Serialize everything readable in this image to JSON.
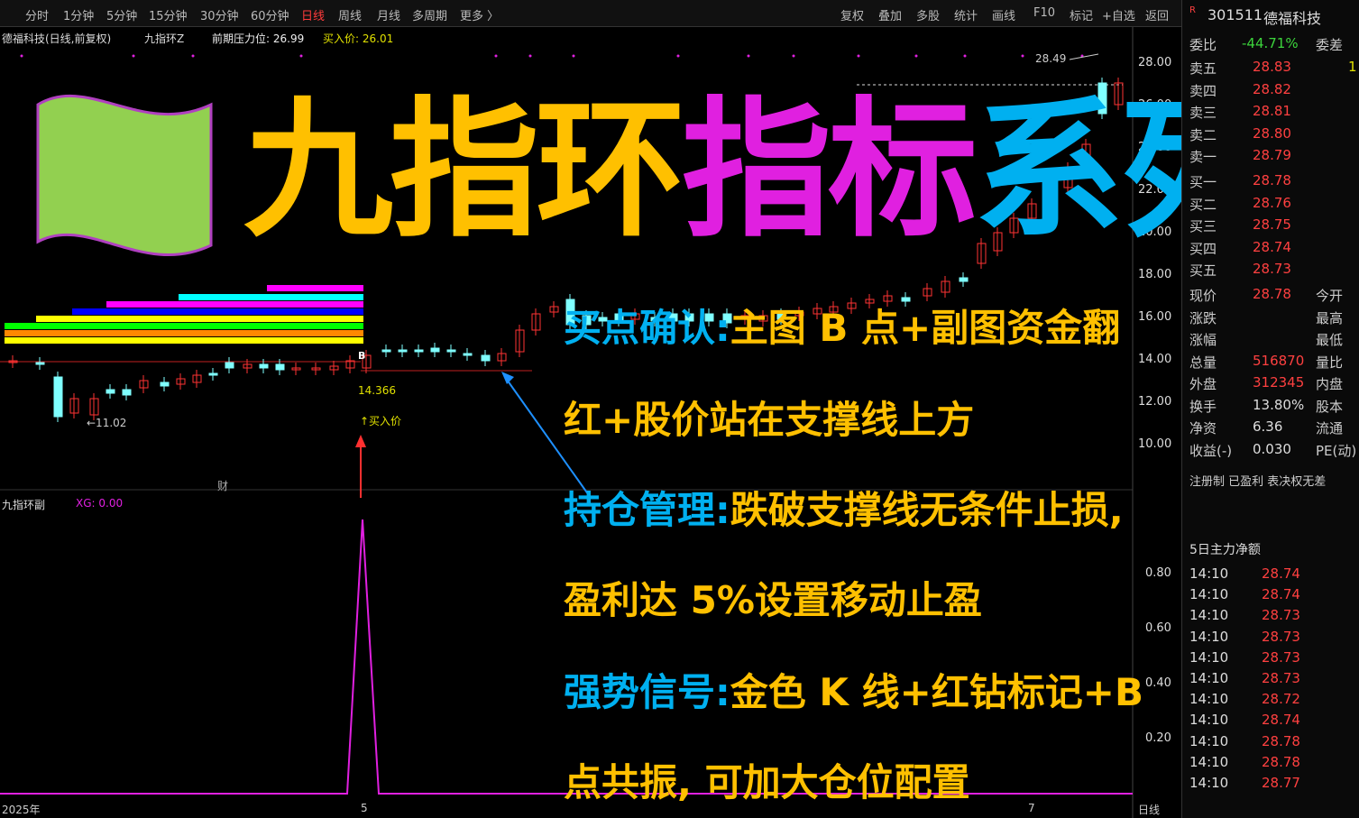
{
  "toolbar": {
    "periods": [
      "分时",
      "1分钟",
      "5分钟",
      "15分钟",
      "30分钟",
      "60分钟",
      "日线",
      "周线",
      "月线",
      "多周期",
      "更多 〉"
    ],
    "active": "日线",
    "tools": [
      "复权",
      "叠加",
      "多股",
      "统计",
      "画线",
      "F10",
      "标记",
      "+自选",
      "返回"
    ]
  },
  "chart": {
    "header_name": "德福科技(日线,前复权)",
    "indicator_name": "九指环Z",
    "pressure_label": "前期压力位: 26.99",
    "buy_price_label": "买入价: 26.01",
    "price_axis": [
      "28.00",
      "26.00",
      "24.00",
      "22.00",
      "20.00",
      "18.00",
      "16.00",
      "14.00",
      "12.00",
      "10.00"
    ],
    "high_marker": "28.49",
    "low_marker": "←11.02",
    "support_value": "14.366",
    "buy_label": "↑买入价",
    "b_marker": "B",
    "finance_marker": "财",
    "sub_name": "九指环副",
    "sub_value": "XG: 0.00",
    "sub_axis": [
      "0.80",
      "0.60",
      "0.40",
      "0.20"
    ],
    "x_start": "2025年",
    "x_mid": "5",
    "x_mid2": "7",
    "x_end": "日线"
  },
  "title": {
    "part1": "九指环",
    "part2": "指标",
    "part3": "系列",
    "color1": "#ffc000",
    "color2": "#e020e0",
    "color3": "#00b0f0"
  },
  "annotations": [
    {
      "head": "买点确认:",
      "body": "主图 B 点+副图资金翻"
    },
    {
      "head": "",
      "body": "红+股价站在支撑线上方"
    },
    {
      "head": "持仓管理:",
      "body": "跌破支撑线无条件止损,"
    },
    {
      "head": "",
      "body": "盈利达 5%设置移动止盈"
    },
    {
      "head": "强势信号:",
      "body": "金色 K 线+红钻标记+B"
    },
    {
      "head": "",
      "body": "点共振, 可加大仓位配置"
    }
  ],
  "quote": {
    "code": "301511",
    "name": "德福科技",
    "ratio_label": "委比",
    "ratio_value": "-44.71%",
    "diff_label": "委差",
    "asks": [
      {
        "label": "卖五",
        "price": "28.83",
        "vol": "1"
      },
      {
        "label": "卖四",
        "price": "28.82",
        "vol": ""
      },
      {
        "label": "卖三",
        "price": "28.81",
        "vol": ""
      },
      {
        "label": "卖二",
        "price": "28.80",
        "vol": ""
      },
      {
        "label": "卖一",
        "price": "28.79",
        "vol": ""
      }
    ],
    "bids": [
      {
        "label": "买一",
        "price": "28.78",
        "vol": ""
      },
      {
        "label": "买二",
        "price": "28.76",
        "vol": ""
      },
      {
        "label": "买三",
        "price": "28.75",
        "vol": ""
      },
      {
        "label": "买四",
        "price": "28.74",
        "vol": ""
      },
      {
        "label": "买五",
        "price": "28.73",
        "vol": ""
      }
    ],
    "stats": [
      {
        "l1": "现价",
        "v1": "28.78",
        "l2": "今开"
      },
      {
        "l1": "涨跌",
        "v1": "",
        "l2": "最高"
      },
      {
        "l1": "涨幅",
        "v1": "",
        "l2": "最低"
      },
      {
        "l1": "总量",
        "v1": "516870",
        "l2": "量比"
      },
      {
        "l1": "外盘",
        "v1": "312345",
        "l2": "内盘"
      },
      {
        "l1": "换手",
        "v1": "13.80%",
        "l2": "股本"
      },
      {
        "l1": "净资",
        "v1": "6.36",
        "l2": "流通"
      },
      {
        "l1": "收益(-)",
        "v1": "0.030",
        "l2": "PE(动)"
      }
    ],
    "tags": "注册制 已盈利 表决权无差",
    "fund_label": "5日主力净额",
    "ticks": [
      {
        "t": "14:10",
        "p": "28.74"
      },
      {
        "t": "14:10",
        "p": "28.74"
      },
      {
        "t": "14:10",
        "p": "28.73"
      },
      {
        "t": "14:10",
        "p": "28.73"
      },
      {
        "t": "14:10",
        "p": "28.73"
      },
      {
        "t": "14:10",
        "p": "28.73"
      },
      {
        "t": "14:10",
        "p": "28.72"
      },
      {
        "t": "14:10",
        "p": "28.74"
      },
      {
        "t": "14:10",
        "p": "28.78"
      },
      {
        "t": "14:10",
        "p": "28.78"
      },
      {
        "t": "14:10",
        "p": "28.77"
      }
    ]
  }
}
